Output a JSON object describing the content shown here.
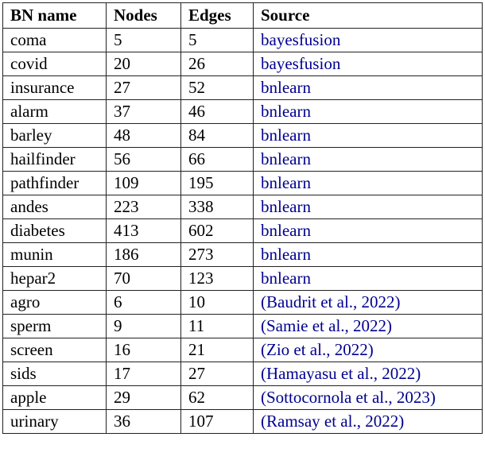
{
  "table": {
    "caption_present": false,
    "columns": [
      {
        "key": "name",
        "label": "BN name"
      },
      {
        "key": "nodes",
        "label": "Nodes"
      },
      {
        "key": "edges",
        "label": "Edges"
      },
      {
        "key": "source",
        "label": "Source"
      }
    ],
    "link_color": "#00008f",
    "text_color": "#000000",
    "border_color": "#222222",
    "rows": [
      {
        "name": "coma",
        "nodes": "5",
        "edges": "5",
        "source": "bayesfusion",
        "source_is_link": true
      },
      {
        "name": "covid",
        "nodes": "20",
        "edges": "26",
        "source": "bayesfusion",
        "source_is_link": true
      },
      {
        "name": "insurance",
        "nodes": "27",
        "edges": "52",
        "source": "bnlearn",
        "source_is_link": true
      },
      {
        "name": "alarm",
        "nodes": "37",
        "edges": "46",
        "source": "bnlearn",
        "source_is_link": true
      },
      {
        "name": "barley",
        "nodes": "48",
        "edges": "84",
        "source": "bnlearn",
        "source_is_link": true
      },
      {
        "name": "hailfinder",
        "nodes": "56",
        "edges": "66",
        "source": "bnlearn",
        "source_is_link": true
      },
      {
        "name": "pathfinder",
        "nodes": "109",
        "edges": "195",
        "source": "bnlearn",
        "source_is_link": true
      },
      {
        "name": "andes",
        "nodes": "223",
        "edges": "338",
        "source": "bnlearn",
        "source_is_link": true
      },
      {
        "name": "diabetes",
        "nodes": "413",
        "edges": "602",
        "source": "bnlearn",
        "source_is_link": true
      },
      {
        "name": "munin",
        "nodes": "186",
        "edges": "273",
        "source": "bnlearn",
        "source_is_link": true
      },
      {
        "name": "hepar2",
        "nodes": "70",
        "edges": "123",
        "source": "bnlearn",
        "source_is_link": true
      },
      {
        "name": "agro",
        "nodes": "6",
        "edges": "10",
        "source": "(Baudrit et al., 2022)",
        "source_is_link": true
      },
      {
        "name": "sperm",
        "nodes": "9",
        "edges": "11",
        "source": "(Samie et al., 2022)",
        "source_is_link": true
      },
      {
        "name": "screen",
        "nodes": "16",
        "edges": "21",
        "source": "(Zio et al., 2022)",
        "source_is_link": true
      },
      {
        "name": "sids",
        "nodes": "17",
        "edges": "27",
        "source": "(Hamayasu et al., 2022)",
        "source_is_link": true
      },
      {
        "name": "apple",
        "nodes": "29",
        "edges": "62",
        "source": "(Sottocornola et al., 2023)",
        "source_is_link": true
      },
      {
        "name": "urinary",
        "nodes": "36",
        "edges": "107",
        "source": "(Ramsay et al., 2022)",
        "source_is_link": true
      }
    ]
  }
}
